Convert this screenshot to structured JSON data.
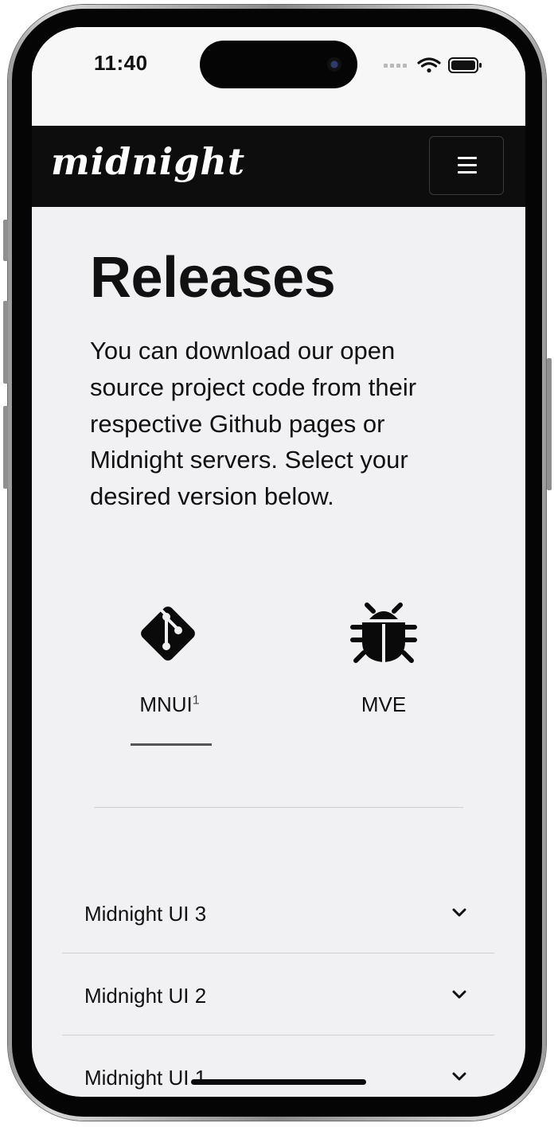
{
  "status_bar": {
    "time": "11:40"
  },
  "navbar": {
    "brand": "midnight",
    "menu_icon": "hamburger-menu-icon"
  },
  "hero": {
    "title": "Releases",
    "description": "You can download our open source project code from their respective Github pages or Midnight servers. Select your desired version below."
  },
  "product_tabs": [
    {
      "label": "MNUI",
      "superscript": "1",
      "icon": "git-icon",
      "selected": true
    },
    {
      "label": "MVE",
      "superscript": "",
      "icon": "bug-icon",
      "selected": false
    }
  ],
  "releases": [
    {
      "label": "Midnight UI 3",
      "icon": "chevron-down-icon"
    },
    {
      "label": "Midnight UI 2",
      "icon": "chevron-down-icon"
    },
    {
      "label": "Midnight UI 1",
      "icon": "chevron-down-icon"
    }
  ],
  "colors": {
    "navbar_bg": "#0d0d0d",
    "page_bg": "#f1f1f3",
    "text": "#111111",
    "tab_underline": "#555555"
  }
}
